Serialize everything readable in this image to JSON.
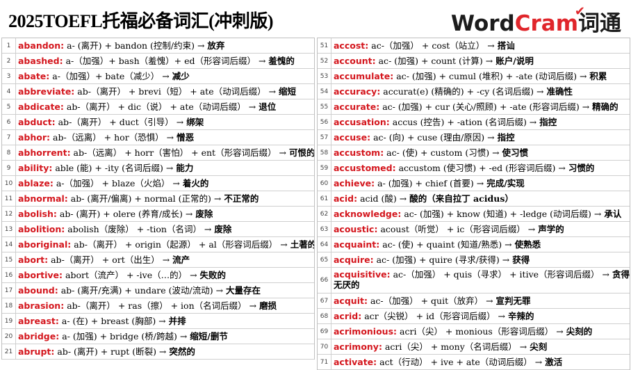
{
  "header": {
    "title": "2025TOEFL托福必备词汇(冲刺版)",
    "logo_word": "Word",
    "logo_cram": "Cram",
    "logo_cn": "词通"
  },
  "left_entries": [
    {
      "num": "1",
      "word": "abandon",
      "parts": "a- (离开) + bandon (控制/约束) →",
      "meaning": "放弃"
    },
    {
      "num": "2",
      "word": "abashed",
      "parts": "a-（加强）+ bash（羞愧）+ ed（形容词后缀） →",
      "meaning": "羞愧的"
    },
    {
      "num": "3",
      "word": "abate",
      "parts": "a-（加强）+ bate（减少） →",
      "meaning": "减少"
    },
    {
      "num": "4",
      "word": "abbreviate",
      "parts": "ab-（离开） + brevi（短） + ate（动词后缀） →",
      "meaning": "缩短"
    },
    {
      "num": "5",
      "word": "abdicate",
      "parts": "ab-（离开） + dic（说） + ate（动词后缀） →",
      "meaning": "退位"
    },
    {
      "num": "6",
      "word": "abduct",
      "parts": "ab-（离开） + duct（引导） →",
      "meaning": "绑架"
    },
    {
      "num": "7",
      "word": "abhor",
      "parts": "ab-（远离） + hor（恐惧） →",
      "meaning": "憎恶"
    },
    {
      "num": "8",
      "word": "abhorrent",
      "parts": "ab-（远离） + horr（害怕） + ent（形容词后缀） →",
      "meaning": "可恨的"
    },
    {
      "num": "9",
      "word": "ability",
      "parts": "able (能) + -ity (名词后缀) →",
      "meaning": "能力"
    },
    {
      "num": "10",
      "word": "ablaze",
      "parts": "a-（加强） + blaze（火焰） →",
      "meaning": "着火的"
    },
    {
      "num": "11",
      "word": "abnormal",
      "parts": "ab- (离开/偏离) + normal (正常的) →",
      "meaning": "不正常的"
    },
    {
      "num": "12",
      "word": "abolish",
      "parts": "ab- (离开) + olere (养育/成长) →",
      "meaning": "废除"
    },
    {
      "num": "13",
      "word": "abolition",
      "parts": "abolish（废除） + -tion（名词） →",
      "meaning": "废除"
    },
    {
      "num": "14",
      "word": "aboriginal",
      "parts": "ab-（离开） + origin（起源） + al（形容词后缀） →",
      "meaning": "土著的"
    },
    {
      "num": "15",
      "word": "abort",
      "parts": "ab-（离开） + ort（出生） →",
      "meaning": "流产"
    },
    {
      "num": "16",
      "word": "abortive",
      "parts": "abort（流产） + -ive（…的） →",
      "meaning": "失败的"
    },
    {
      "num": "17",
      "word": "abound",
      "parts": "ab- (离开/充满) + undare (波动/流动) →",
      "meaning": "大量存在"
    },
    {
      "num": "18",
      "word": "abrasion",
      "parts": "ab-（离开） + ras（擦） + ion（名词后缀） →",
      "meaning": "磨损"
    },
    {
      "num": "19",
      "word": "abreast",
      "parts": "a- (在) + breast (胸部) →",
      "meaning": "并排"
    },
    {
      "num": "20",
      "word": "abridge",
      "parts": "a- (加强) + bridge (桥/跨越) →",
      "meaning": "缩短/删节"
    },
    {
      "num": "21",
      "word": "abrupt",
      "parts": "ab- (离开) + rupt (断裂) →",
      "meaning": "突然的"
    }
  ],
  "right_entries": [
    {
      "num": "51",
      "word": "accost",
      "parts": "ac-（加强） + cost（站立） →",
      "meaning": "搭讪"
    },
    {
      "num": "52",
      "word": "account",
      "parts": "ac- (加强) + count (计算) →",
      "meaning": "账户/说明"
    },
    {
      "num": "53",
      "word": "accumulate",
      "parts": "ac- (加强) + cumul (堆积) + -ate (动词后缀) →",
      "meaning": "积累"
    },
    {
      "num": "54",
      "word": "accuracy",
      "parts": "accurat(e) (精确的) + -cy (名词后缀) →",
      "meaning": "准确性"
    },
    {
      "num": "55",
      "word": "accurate",
      "parts": "ac- (加强) + cur (关心/照顾) + -ate (形容词后缀) →",
      "meaning": "精确的"
    },
    {
      "num": "56",
      "word": "accusation",
      "parts": "accus (控告) + -ation (名词后缀) →",
      "meaning": "指控"
    },
    {
      "num": "57",
      "word": "accuse",
      "parts": "ac- (向) + cuse (理由/原因) →",
      "meaning": "指控"
    },
    {
      "num": "58",
      "word": "accustom",
      "parts": "ac- (使) + custom (习惯) →",
      "meaning": "使习惯"
    },
    {
      "num": "59",
      "word": "accustomed",
      "parts": "accustom (使习惯) + -ed (形容词后缀) →",
      "meaning": "习惯的"
    },
    {
      "num": "60",
      "word": "achieve",
      "parts": "a- (加强) + chief (首要) →",
      "meaning": "完成/实现"
    },
    {
      "num": "61",
      "word": "acid",
      "parts": "acid (酸) →",
      "meaning": "酸的（来自拉丁 acidus）"
    },
    {
      "num": "62",
      "word": "acknowledge",
      "parts": "ac- (加强) + know (知道) + -ledge (动词后缀) →",
      "meaning": "承认"
    },
    {
      "num": "63",
      "word": "acoustic",
      "parts": "acoust（听觉） + ic（形容词后缀） →",
      "meaning": "声学的"
    },
    {
      "num": "64",
      "word": "acquaint",
      "parts": "ac- (使) + quaint (知道/熟悉) →",
      "meaning": "使熟悉"
    },
    {
      "num": "65",
      "word": "acquire",
      "parts": "ac- (加强) + quire (寻求/获得) →",
      "meaning": "获得"
    },
    {
      "num": "66",
      "word": "acquisitive",
      "parts": "ac-（加强） + quis（寻求） + itive（形容词后缀） →",
      "meaning": "贪得无厌的",
      "tall": true
    },
    {
      "num": "67",
      "word": "acquit",
      "parts": "ac-（加强） + quit（放弃） →",
      "meaning": "宣判无罪"
    },
    {
      "num": "68",
      "word": "acrid",
      "parts": "acr（尖锐） + id（形容词后缀） →",
      "meaning": "辛辣的"
    },
    {
      "num": "69",
      "word": "acrimonious",
      "parts": "acri（尖） + monious（形容词后缀） →",
      "meaning": "尖刻的"
    },
    {
      "num": "70",
      "word": "acrimony",
      "parts": "acri（尖） + mony（名词后缀） →",
      "meaning": "尖刻"
    },
    {
      "num": "71",
      "word": "activate",
      "parts": "act（行动） + ive + ate（动词后缀） →",
      "meaning": "激活"
    }
  ]
}
